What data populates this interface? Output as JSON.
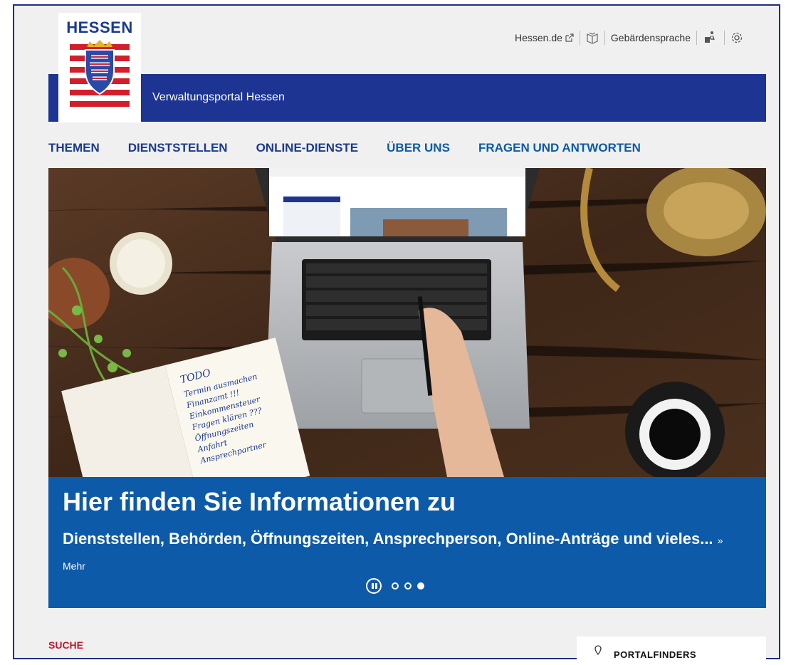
{
  "header": {
    "logo_text": "HESSEN",
    "portal_title": "Verwaltungsportal Hessen",
    "links": {
      "hessen_de": "Hessen.de",
      "gebaerdensprache": "Gebärdensprache"
    },
    "icons": [
      "external-link-icon",
      "leichte-sprache-icon",
      "sign-language-icon",
      "settings-icon"
    ]
  },
  "nav": {
    "items": [
      "THEMEN",
      "DIENSTSTELLEN",
      "ONLINE-DIENSTE",
      "ÜBER UNS",
      "FRAGEN UND ANTWORTEN"
    ]
  },
  "hero": {
    "headline": "Hier finden Sie Informationen zu",
    "subline": "Dienststellen, Behörden, Öffnungszeiten, Ansprechperson, Online-Anträge und vieles...",
    "more_link": "» Mehr",
    "slides_total": 3,
    "active_slide": 3,
    "notebook_text": [
      "TODO",
      "Termin ausmachen",
      "Finanzamt !!!",
      "Einkommensteuer",
      "Fragen klären ???",
      "Öffnungszeiten",
      "Anfahrt",
      "Ansprechpartner"
    ]
  },
  "content": {
    "search_label": "SUCHE",
    "side_box_label": "PORTALFINDERS"
  },
  "colors": {
    "brand_blue": "#1d3493",
    "caption_blue": "#0d5aa8",
    "nav_blue": "#1a3a8f",
    "accent_red": "#c0182b"
  }
}
